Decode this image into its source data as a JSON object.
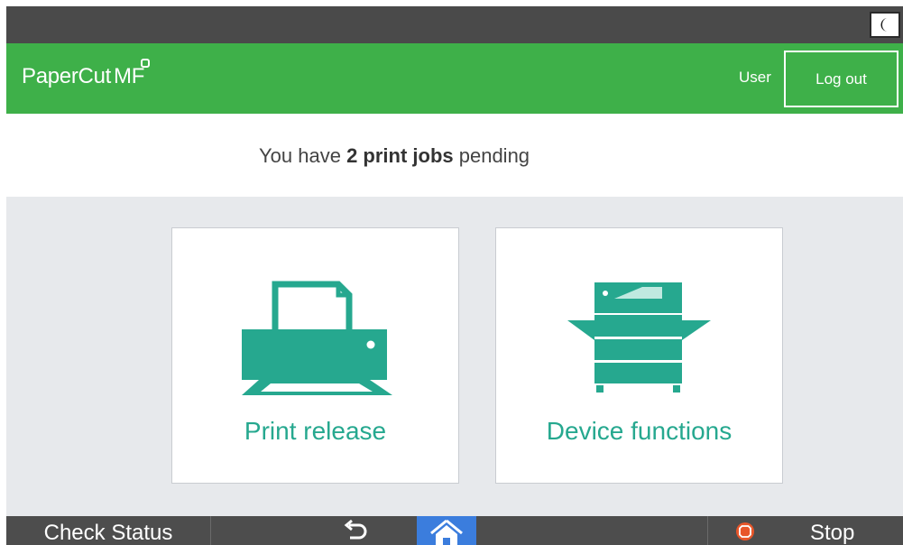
{
  "header": {
    "brand_prefix": "PaperCut",
    "brand_suffix": "MF",
    "user_label": "User",
    "logout_label": "Log out",
    "accent_color": "#3eb049"
  },
  "banner": {
    "text_before": "You have ",
    "highlight": "2 print jobs",
    "text_after": " pending"
  },
  "tiles": [
    {
      "label": "Print release",
      "icon": "printer-icon"
    },
    {
      "label": "Device functions",
      "icon": "copier-icon"
    }
  ],
  "tile_color": "#26a88f",
  "bottom_bar": {
    "check_status_label": "Check Status",
    "back_icon": "back-arrow-icon",
    "home_icon": "home-icon",
    "stop_icon": "stop-icon",
    "stop_label": "Stop",
    "home_color": "#3b7ddd",
    "stop_color": "#e8562a"
  },
  "top_bar": {
    "sleep_icon": "moon-icon"
  }
}
